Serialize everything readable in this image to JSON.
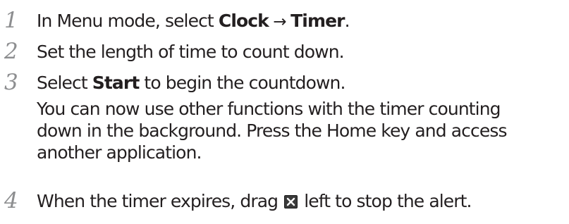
{
  "steps": [
    {
      "number": "1",
      "pre": "In Menu mode, select ",
      "bold1": "Clock",
      "arrow": " → ",
      "bold2": "Timer",
      "post": "."
    },
    {
      "number": "2",
      "text": "Set the length of time to count down."
    },
    {
      "number": "3",
      "pre": "Select ",
      "bold": "Start",
      "post": " to begin the countdown.",
      "note_lines": [
        "You can now use other functions with the timer counting",
        "down in the background. Press the Home key and access",
        "another application."
      ]
    },
    {
      "number": "4",
      "pre": "When the timer expires, drag ",
      "icon": "close-x-icon",
      "post": " left to stop the alert."
    }
  ]
}
